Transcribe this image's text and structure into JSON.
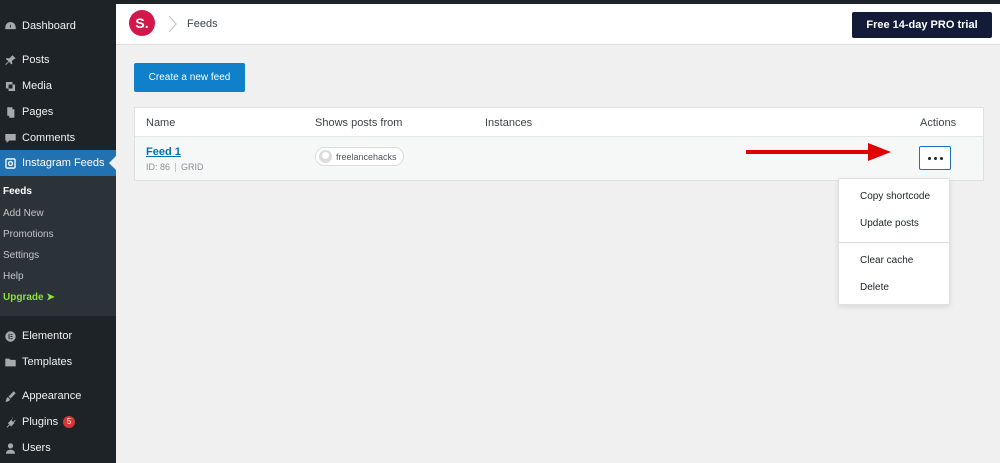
{
  "sidebar": {
    "items": [
      {
        "label": "Dashboard",
        "icon": "dashboard-icon"
      },
      {
        "label": "Posts",
        "icon": "pin-icon"
      },
      {
        "label": "Media",
        "icon": "media-icon"
      },
      {
        "label": "Pages",
        "icon": "pages-icon"
      },
      {
        "label": "Comments",
        "icon": "comment-icon"
      },
      {
        "label": "Instagram Feeds",
        "icon": "instagram-icon"
      },
      {
        "label": "Elementor",
        "icon": "elementor-icon"
      },
      {
        "label": "Templates",
        "icon": "folder-icon"
      },
      {
        "label": "Appearance",
        "icon": "brush-icon"
      },
      {
        "label": "Plugins",
        "icon": "plugin-icon",
        "badge": "5"
      },
      {
        "label": "Users",
        "icon": "user-icon"
      }
    ],
    "submenu": [
      {
        "label": "Feeds"
      },
      {
        "label": "Add New"
      },
      {
        "label": "Promotions"
      },
      {
        "label": "Settings"
      },
      {
        "label": "Help"
      },
      {
        "label": "Upgrade ➤"
      }
    ]
  },
  "topbar": {
    "logo_letter": "S.",
    "breadcrumb": "Feeds",
    "pro_button": "Free 14-day PRO trial"
  },
  "main": {
    "create_button": "Create a new feed",
    "table": {
      "headers": [
        "Name",
        "Shows posts from",
        "Instances",
        "Actions"
      ],
      "rows": [
        {
          "name": "Feed 1",
          "id": "ID: 86",
          "layout": "GRID",
          "source": "freelancehacks"
        }
      ]
    },
    "dropdown": {
      "items": [
        "Copy shortcode",
        "Update posts",
        "Clear cache",
        "Delete"
      ]
    }
  },
  "colors": {
    "sidebar_bg": "#1d2327",
    "active": "#2271b1",
    "create_button": "#0f80c9",
    "pro_button": "#141b38",
    "logo": "#d4174a",
    "arrow": "#e00000",
    "upgrade": "#8ddf3a"
  }
}
